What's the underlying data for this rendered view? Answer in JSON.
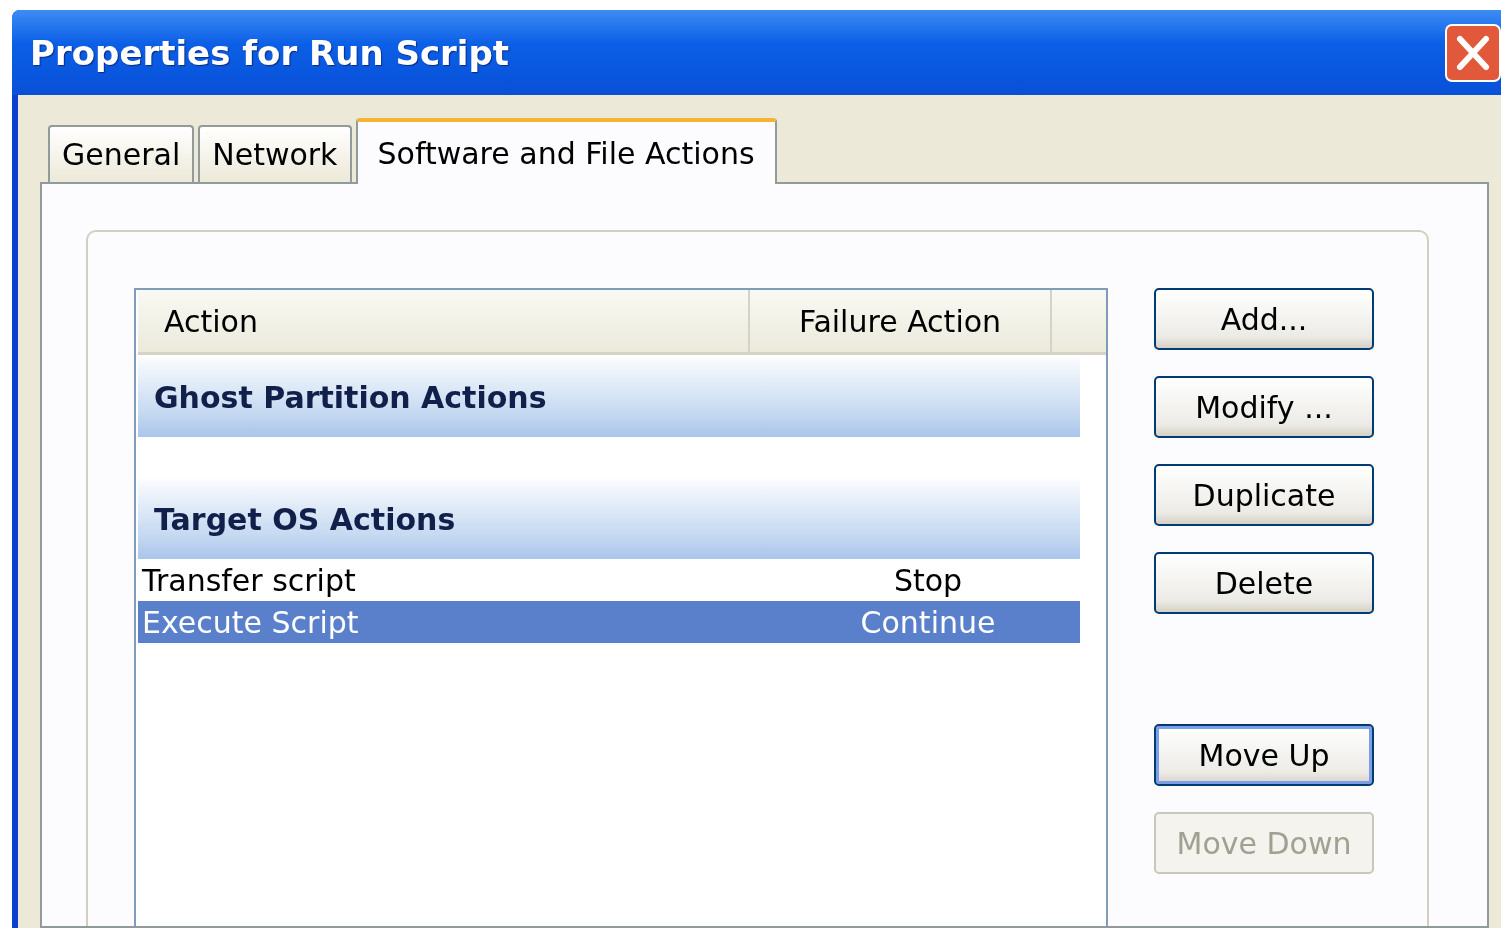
{
  "window": {
    "title": "Properties for Run Script"
  },
  "tabs": [
    {
      "label": "General",
      "selected": false
    },
    {
      "label": "Network",
      "selected": false
    },
    {
      "label": "Software and File Actions",
      "selected": true
    }
  ],
  "list": {
    "columns": [
      "Action",
      "Failure Action"
    ],
    "groups": [
      {
        "title": "Ghost Partition Actions"
      },
      {
        "title": "Target OS Actions",
        "rows": [
          {
            "action": "Transfer script",
            "failure_action": "Stop",
            "selected": false
          },
          {
            "action": "Execute Script",
            "failure_action": "Continue",
            "selected": true
          }
        ]
      }
    ]
  },
  "edit_buttons": [
    {
      "label": "Add...",
      "disabled": false,
      "default": false
    },
    {
      "label": "Modify ...",
      "disabled": false,
      "default": false
    },
    {
      "label": "Duplicate",
      "disabled": false,
      "default": false
    },
    {
      "label": "Delete",
      "disabled": false,
      "default": false
    }
  ],
  "order_buttons": [
    {
      "label": "Move Up",
      "disabled": false,
      "default": true
    },
    {
      "label": "Move Down",
      "disabled": true,
      "default": false
    }
  ]
}
